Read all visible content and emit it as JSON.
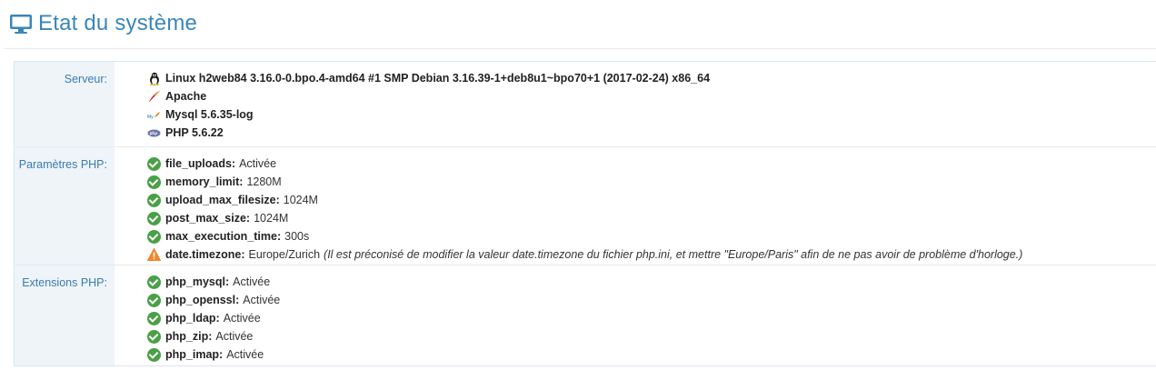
{
  "page": {
    "title": "Etat du système"
  },
  "sections": {
    "server": {
      "label": "Serveur:",
      "items": [
        {
          "icon": "linux-tux-icon",
          "text": "Linux h2web84 3.16.0-0.bpo.4-amd64 #1 SMP Debian 3.16.39-1+deb8u1~bpo70+1 (2017-02-24) x86_64"
        },
        {
          "icon": "apache-feather-icon",
          "text": "Apache"
        },
        {
          "icon": "mysql-icon",
          "text": "Mysql 5.6.35-log"
        },
        {
          "icon": "php-icon",
          "text": "PHP 5.6.22"
        }
      ]
    },
    "php_params": {
      "label": "Paramètres PHP:",
      "items": [
        {
          "status": "ok",
          "key": "file_uploads:",
          "value": "Activée"
        },
        {
          "status": "ok",
          "key": "memory_limit:",
          "value": "1280M"
        },
        {
          "status": "ok",
          "key": "upload_max_filesize:",
          "value": "1024M"
        },
        {
          "status": "ok",
          "key": "post_max_size:",
          "value": "1024M"
        },
        {
          "status": "ok",
          "key": "max_execution_time:",
          "value": "300s"
        },
        {
          "status": "warning",
          "key": "date.timezone:",
          "value": "Europe/Zurich",
          "note": "(Il est préconisé de modifier la valeur date.timezone du fichier php.ini, et mettre \"Europe/Paris\" afin de ne pas avoir de problème d'horloge.)"
        }
      ]
    },
    "php_extensions": {
      "label": "Extensions PHP:",
      "items": [
        {
          "status": "ok",
          "key": "php_mysql:",
          "value": "Activée"
        },
        {
          "status": "ok",
          "key": "php_openssl:",
          "value": "Activée"
        },
        {
          "status": "ok",
          "key": "php_ldap:",
          "value": "Activée"
        },
        {
          "status": "ok",
          "key": "php_zip:",
          "value": "Activée"
        },
        {
          "status": "ok",
          "key": "php_imap:",
          "value": "Activée"
        }
      ]
    }
  },
  "colors": {
    "title": "#3a86b8",
    "ok": "#4aa047",
    "warning": "#f0862a",
    "label": "#3a7bb0"
  }
}
